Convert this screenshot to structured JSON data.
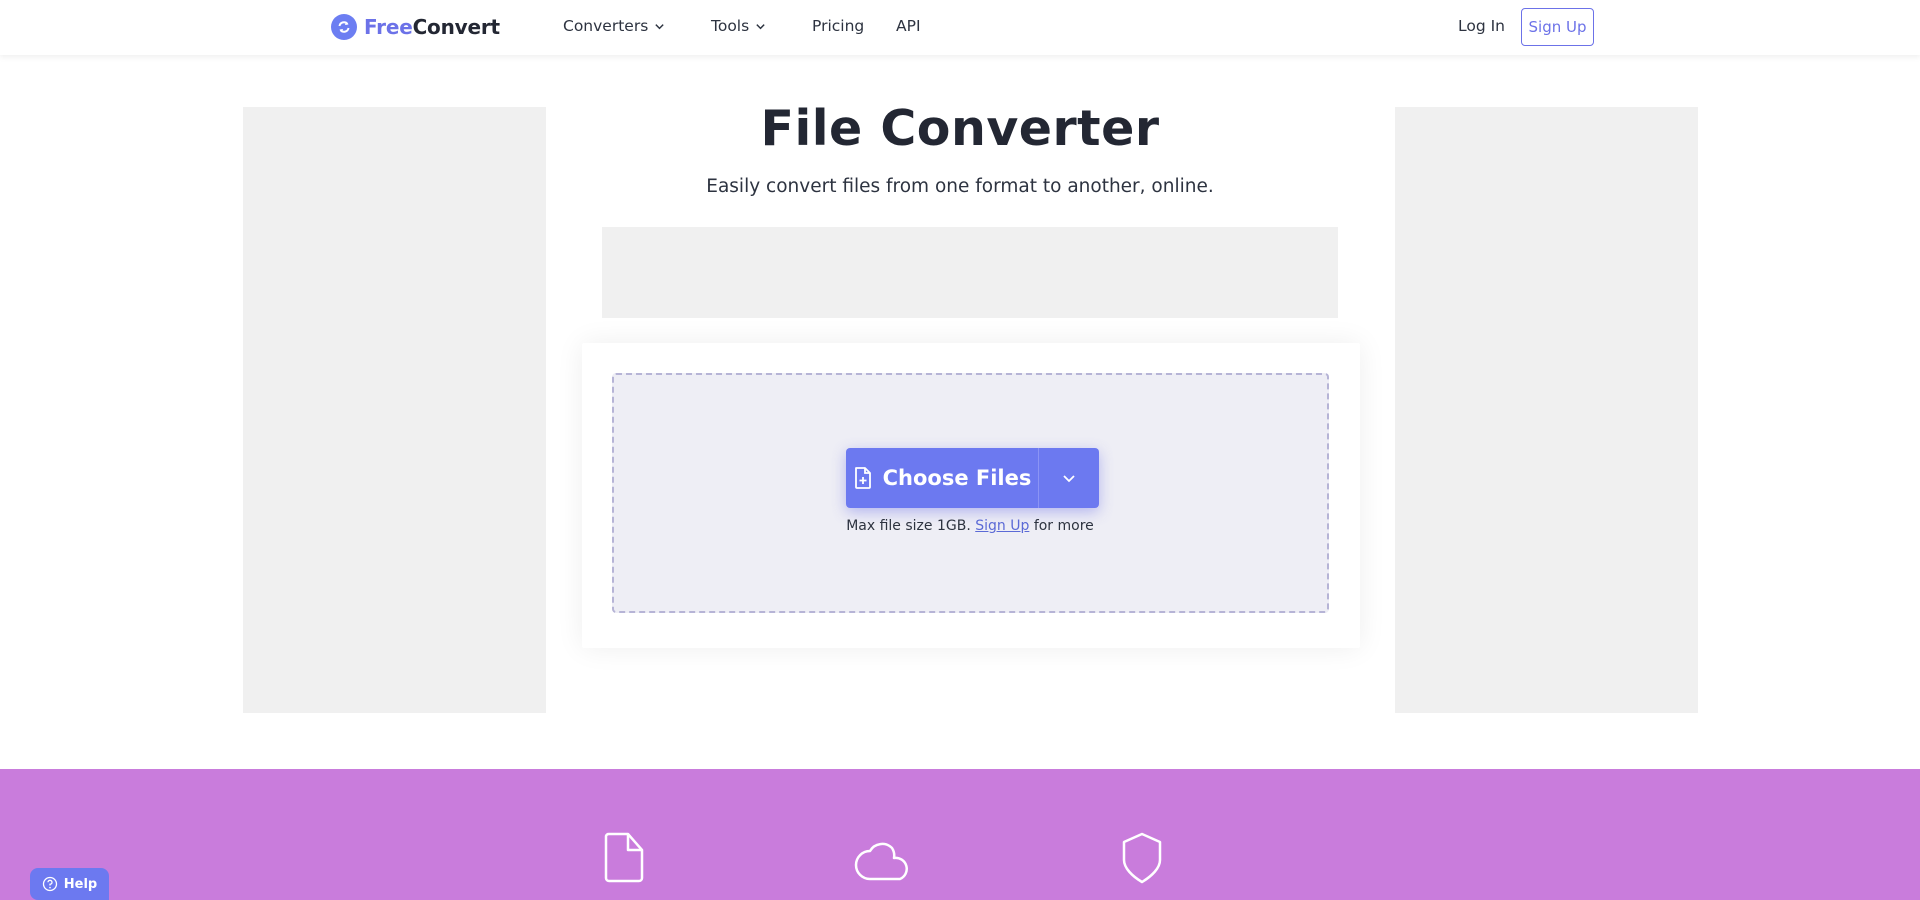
{
  "brand": {
    "name_part1": "Free",
    "name_part2": "Convert",
    "accent": "#6c72e8"
  },
  "nav": {
    "items": [
      {
        "label": "Converters",
        "has_dropdown": true
      },
      {
        "label": "Tools",
        "has_dropdown": true
      },
      {
        "label": "Pricing",
        "has_dropdown": false
      },
      {
        "label": "API",
        "has_dropdown": false
      }
    ],
    "login_label": "Log In",
    "signup_label": "Sign Up"
  },
  "hero": {
    "title": "File Converter",
    "subtitle": "Easily convert files from one format to another, online."
  },
  "upload": {
    "choose_label": "Choose Files",
    "choose_icon": "file-plus-icon",
    "dropdown_icon": "chevron-down-icon",
    "max_text_before": "Max file size 1GB.",
    "max_link": "Sign Up",
    "max_text_after": "for more"
  },
  "features": {
    "icons": [
      "file-icon",
      "cloud-icon",
      "shield-icon"
    ],
    "background": "#c97cdc"
  },
  "help": {
    "label": "Help"
  }
}
